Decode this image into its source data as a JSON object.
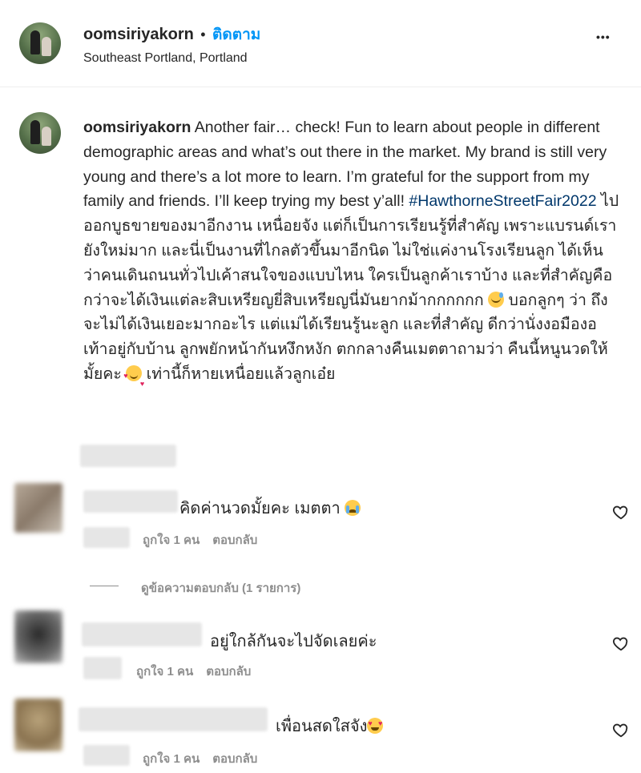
{
  "header": {
    "username": "oomsiriyakorn",
    "separator": "•",
    "follow_label": "ติดตาม",
    "location": "Southeast Portland, Portland",
    "more_label": "•••"
  },
  "caption": {
    "username": "oomsiriyakorn",
    "text_before_tag": " Another fair… check! Fun to learn about people in different demographic areas and what’s out there in the market. My brand is still very young and there’s a lot more to learn. I’m grateful for the support from my family and friends. I’ll keep trying my best y’all! ",
    "hashtag": "#HawthorneStreetFair2022",
    "text_thai_1": " ไปออกบูธขายของมาอีกงาน เหนื่อยจัง แต่ก็เป็นการเรียนรู้ที่สำคัญ เพราะแบรนด์เรายังใหม่มาก และนี่เป็นงานที่ไกลตัวขึ้นมาอีกนิด ไม่ใช่แค่งานโรงเรียนลูก ได้เห็นว่าคนเดินถนนทั่วไปเค้าสนใจของแบบไหน ใครเป็นลูกค้าเราบ้าง และที่สำคัญคือ กว่าจะได้เงินแต่ละสิบเหรียญยี่สิบเหรียญนี่มันยากม้ากกกกกก ",
    "emoji_1": "sweat-smile-emoji",
    "text_thai_2": " บอกลูกๆ ว่า ถึงจะไม่ได้เงินเยอะมากอะไร แต่แม่ได้เรียนรู้นะลูก และที่สำคัญ ดีกว่านั่งงอมืองอเท้าอยู่กับบ้าน ลูกพยักหน้ากันหงึกหงัก ตกกลางคืนเมตตาถามว่า คืนนี้หนูนวดให้มั้ยคะ ",
    "emoji_2": "smiling-hearts-emoji",
    "text_thai_3": " เท่านี้ก็หายเหนื่อยแล้วลูกเอ๋ย"
  },
  "comments": [
    {
      "text": "คิดค่านวดมั้ยคะ เมตตา",
      "emoji": "crying-face-emoji",
      "likes": "ถูกใจ 1 คน",
      "reply_label": "ตอบกลับ",
      "view_replies": "ดูข้อความตอบกลับ (1 รายการ)"
    },
    {
      "text": "อยู่ใกล้กันจะไปจัดเลยค่ะ",
      "likes": "ถูกใจ 1 คน",
      "reply_label": "ตอบกลับ"
    },
    {
      "text": "เพื่อนสดใสจัง",
      "emoji": "heart-eyes-emoji",
      "likes": "ถูกใจ 1 คน",
      "reply_label": "ตอบกลับ"
    }
  ],
  "colors": {
    "link_blue": "#0095f6",
    "hashtag_navy": "#00376b",
    "secondary_text": "#8e8e8e",
    "divider": "#efefef"
  }
}
